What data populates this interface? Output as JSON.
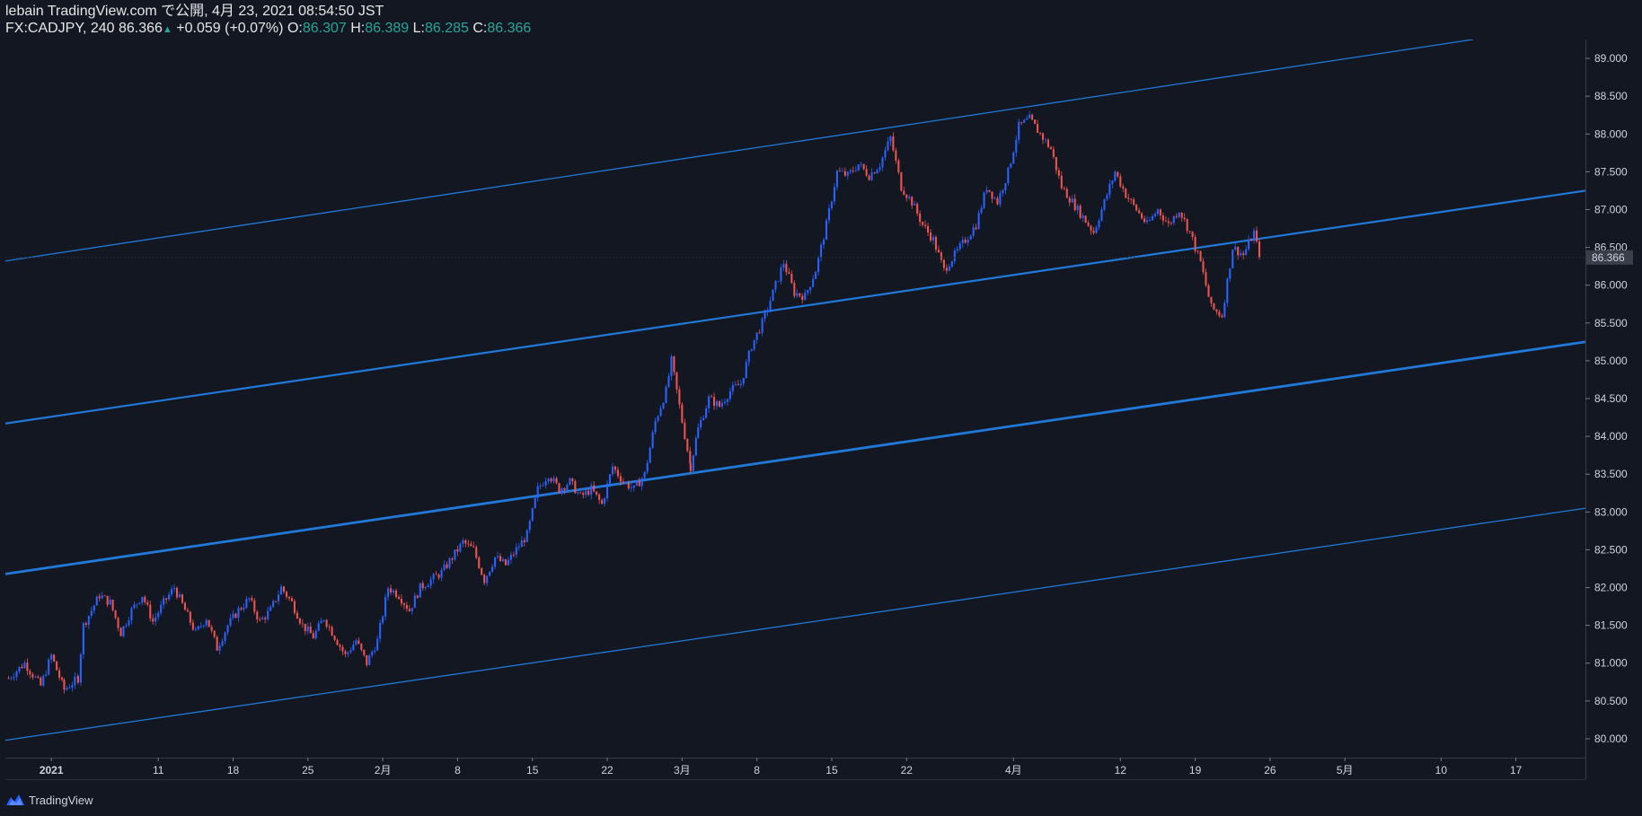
{
  "header": {
    "line1": "lebain TradingView.com で公開, 4月 23, 2021 08:54:50 JST",
    "symbol_interval": "FX:CADJPY, 240",
    "last": "86.366",
    "change": "+0.059 (+0.07%)",
    "o_label": "O:",
    "o": "86.307",
    "h_label": "H:",
    "h": "86.389",
    "l_label": "L:",
    "l": "86.285",
    "c_label": "C:",
    "c": "86.366",
    "up_icon": "triangle-up-icon"
  },
  "footer": {
    "brand": "TradingView",
    "logo_icon": "tradingview-logo-icon"
  },
  "colors": {
    "background": "#131722",
    "up_candle": "#2962ff",
    "down_candle": "#ef5350",
    "channel_line": "#2179d9",
    "axis_text": "#d1d4dc",
    "price_label_bg": "#3a3e4a"
  },
  "chart_data": {
    "type": "candlestick",
    "symbol": "FX:CADJPY",
    "interval": "240",
    "ylim": [
      79.75,
      89.25
    ],
    "y_ticks": [
      "80.000",
      "80.500",
      "81.000",
      "81.500",
      "82.000",
      "82.500",
      "83.000",
      "83.500",
      "84.000",
      "84.500",
      "85.000",
      "85.500",
      "86.000",
      "86.500",
      "87.000",
      "87.500",
      "88.000",
      "88.500",
      "89.000"
    ],
    "x_ticks": [
      {
        "label": "2021",
        "t": 0.0,
        "bold": true
      },
      {
        "label": "11",
        "t": 10,
        "bold": false
      },
      {
        "label": "18",
        "t": 17,
        "bold": false
      },
      {
        "label": "25",
        "t": 24,
        "bold": false
      },
      {
        "label": "2月",
        "t": 31,
        "bold": false
      },
      {
        "label": "8",
        "t": 38,
        "bold": false
      },
      {
        "label": "15",
        "t": 45,
        "bold": false
      },
      {
        "label": "22",
        "t": 52,
        "bold": false
      },
      {
        "label": "3月",
        "t": 59,
        "bold": false
      },
      {
        "label": "8",
        "t": 66,
        "bold": false
      },
      {
        "label": "15",
        "t": 73,
        "bold": false
      },
      {
        "label": "22",
        "t": 80,
        "bold": false
      },
      {
        "label": "4月",
        "t": 90,
        "bold": false
      },
      {
        "label": "12",
        "t": 100,
        "bold": false
      },
      {
        "label": "19",
        "t": 107,
        "bold": false
      },
      {
        "label": "26",
        "t": 114,
        "bold": false
      },
      {
        "label": "5月",
        "t": 121,
        "bold": false
      },
      {
        "label": "10",
        "t": 130,
        "bold": false
      },
      {
        "label": "17",
        "t": 137,
        "bold": false
      }
    ],
    "xlim": [
      -4.3,
      143.5
    ],
    "last_price": 86.366,
    "last_price_label": "86.366",
    "path": [
      [
        -4.0,
        80.8
      ],
      [
        -2.5,
        81.0
      ],
      [
        -1.0,
        80.7
      ],
      [
        0.0,
        81.1
      ],
      [
        1.2,
        80.65
      ],
      [
        2.5,
        80.8
      ],
      [
        3.0,
        81.5
      ],
      [
        4.5,
        81.9
      ],
      [
        5.5,
        81.8
      ],
      [
        6.5,
        81.4
      ],
      [
        7.5,
        81.7
      ],
      [
        8.5,
        81.9
      ],
      [
        9.5,
        81.55
      ],
      [
        10.5,
        81.8
      ],
      [
        11.5,
        82.0
      ],
      [
        12.5,
        81.7
      ],
      [
        13.5,
        81.4
      ],
      [
        14.5,
        81.6
      ],
      [
        15.5,
        81.2
      ],
      [
        16.5,
        81.5
      ],
      [
        17.5,
        81.7
      ],
      [
        18.5,
        81.85
      ],
      [
        19.5,
        81.55
      ],
      [
        20.5,
        81.7
      ],
      [
        21.5,
        82.0
      ],
      [
        22.5,
        81.8
      ],
      [
        23.5,
        81.5
      ],
      [
        24.5,
        81.35
      ],
      [
        25.5,
        81.6
      ],
      [
        26.5,
        81.35
      ],
      [
        27.5,
        81.1
      ],
      [
        28.5,
        81.3
      ],
      [
        29.5,
        81.0
      ],
      [
        30.5,
        81.3
      ],
      [
        31.5,
        82.0
      ],
      [
        32.5,
        81.9
      ],
      [
        33.5,
        81.7
      ],
      [
        34.5,
        82.0
      ],
      [
        35.5,
        82.1
      ],
      [
        36.5,
        82.2
      ],
      [
        37.5,
        82.4
      ],
      [
        38.5,
        82.6
      ],
      [
        39.5,
        82.5
      ],
      [
        40.5,
        82.1
      ],
      [
        41.5,
        82.4
      ],
      [
        42.5,
        82.3
      ],
      [
        43.5,
        82.5
      ],
      [
        44.5,
        82.7
      ],
      [
        45.5,
        83.3
      ],
      [
        46.5,
        83.5
      ],
      [
        47.5,
        83.3
      ],
      [
        48.5,
        83.4
      ],
      [
        49.5,
        83.2
      ],
      [
        50.5,
        83.3
      ],
      [
        51.5,
        83.1
      ],
      [
        52.5,
        83.6
      ],
      [
        53.5,
        83.4
      ],
      [
        54.5,
        83.3
      ],
      [
        55.5,
        83.5
      ],
      [
        56.5,
        84.2
      ],
      [
        57.5,
        84.6
      ],
      [
        58.0,
        85.0
      ],
      [
        59.0,
        84.2
      ],
      [
        59.8,
        83.6
      ],
      [
        60.5,
        84.1
      ],
      [
        61.5,
        84.5
      ],
      [
        62.5,
        84.4
      ],
      [
        63.5,
        84.6
      ],
      [
        64.5,
        84.7
      ],
      [
        65.5,
        85.2
      ],
      [
        66.5,
        85.5
      ],
      [
        67.5,
        85.9
      ],
      [
        68.5,
        86.3
      ],
      [
        69.5,
        85.9
      ],
      [
        70.5,
        85.85
      ],
      [
        71.5,
        86.2
      ],
      [
        72.5,
        86.8
      ],
      [
        73.5,
        87.5
      ],
      [
        74.5,
        87.45
      ],
      [
        75.5,
        87.6
      ],
      [
        76.5,
        87.45
      ],
      [
        77.5,
        87.6
      ],
      [
        78.5,
        87.95
      ],
      [
        79.5,
        87.3
      ],
      [
        80.5,
        87.1
      ],
      [
        81.5,
        86.8
      ],
      [
        82.5,
        86.6
      ],
      [
        83.5,
        86.2
      ],
      [
        84.5,
        86.4
      ],
      [
        85.5,
        86.6
      ],
      [
        86.5,
        86.8
      ],
      [
        87.5,
        87.3
      ],
      [
        88.5,
        87.1
      ],
      [
        89.5,
        87.5
      ],
      [
        90.5,
        88.1
      ],
      [
        91.5,
        88.2
      ],
      [
        92.5,
        88.0
      ],
      [
        93.5,
        87.8
      ],
      [
        94.5,
        87.3
      ],
      [
        95.5,
        87.1
      ],
      [
        96.5,
        86.9
      ],
      [
        97.5,
        86.7
      ],
      [
        98.5,
        87.1
      ],
      [
        99.5,
        87.5
      ],
      [
        100.5,
        87.2
      ],
      [
        101.5,
        87.0
      ],
      [
        102.5,
        86.8
      ],
      [
        103.5,
        87.0
      ],
      [
        104.5,
        86.8
      ],
      [
        105.5,
        87.0
      ],
      [
        106.5,
        86.7
      ],
      [
        107.5,
        86.3
      ],
      [
        108.5,
        85.7
      ],
      [
        109.5,
        85.6
      ],
      [
        110.5,
        86.5
      ],
      [
        111.5,
        86.4
      ],
      [
        112.5,
        86.7
      ],
      [
        113.0,
        86.37
      ]
    ],
    "channel_lines": [
      {
        "name": "upper",
        "x": [
          -4.3,
          133.0
        ],
        "y": [
          86.32,
          89.25
        ],
        "width": 1.3
      },
      {
        "name": "mid-upper",
        "x": [
          -4.3,
          143.5
        ],
        "y": [
          84.17,
          87.25
        ],
        "width": 2.2
      },
      {
        "name": "mid-lower",
        "x": [
          -4.3,
          143.5
        ],
        "y": [
          82.18,
          85.25
        ],
        "width": 2.8
      },
      {
        "name": "lower",
        "x": [
          -4.3,
          143.5
        ],
        "y": [
          79.98,
          83.05
        ],
        "width": 1.3
      }
    ]
  }
}
